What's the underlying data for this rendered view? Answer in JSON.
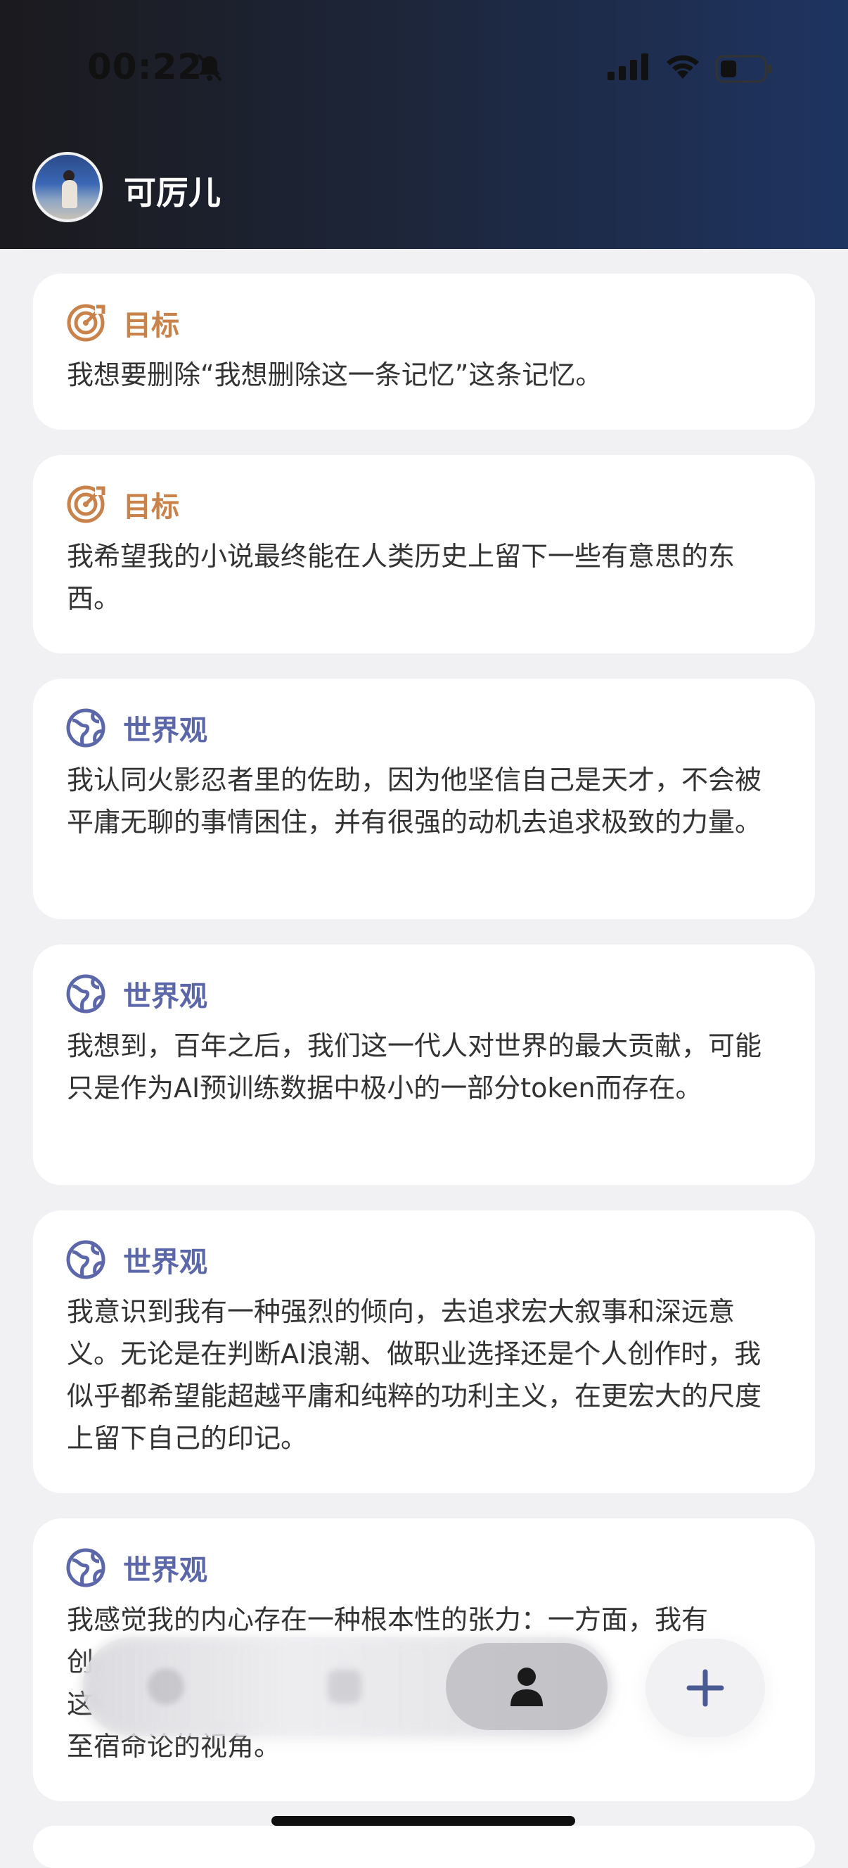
{
  "status_bar": {
    "time": "00:22"
  },
  "header": {
    "username": "可厉儿"
  },
  "cards": [
    {
      "type": "goal",
      "label": "目标",
      "icon": "target-icon",
      "text": "我想要删除“我想删除这一条记忆”这条记忆。"
    },
    {
      "type": "goal",
      "label": "目标",
      "icon": "target-icon",
      "text": "我希望我的小说最终能在人类历史上留下一些有意思的东西。"
    },
    {
      "type": "worldview",
      "label": "世界观",
      "icon": "globe-icon",
      "text": "我认同火影忍者里的佐助，因为他坚信自己是天才，不会被平庸无聊的事情困住，并有很强的动机去追求极致的力量。"
    },
    {
      "type": "worldview",
      "label": "世界观",
      "icon": "globe-icon",
      "text": "我想到，百年之后，我们这一代人对世界的最大贡献，可能只是作为AI预训练数据中极小的一部分token而存在。"
    },
    {
      "type": "worldview",
      "label": "世界观",
      "icon": "globe-icon",
      "text": "我意识到我有一种强烈的倾向，去追求宏大叙事和深远意义。无论是在判断AI浪潮、做职业选择还是个人创作时，我似乎都希望能超越平庸和纯粹的功利主义，在更宏大的尺度上留下自己的印记。"
    },
    {
      "type": "worldview",
      "label": "世界观",
      "icon": "globe-icon",
      "text_visible": [
        "我感觉我的内心存在一种根本性的张力：一方面，我有",
        "创",
        "这",
        "至宿命论的视角。"
      ]
    }
  ],
  "colors": {
    "goal_accent": "#c9824a",
    "worldview_accent": "#5b67a9",
    "header_gradient_start": "#1b1a1e",
    "header_gradient_end": "#1e3461",
    "background": "#f1f1f3"
  },
  "nav": {
    "items": [
      "blurred-item",
      "blurred-item",
      "person-icon"
    ],
    "add_button_icon": "plus-icon"
  }
}
